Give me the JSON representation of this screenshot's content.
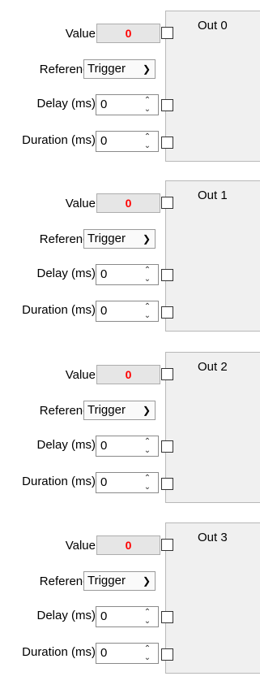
{
  "labels": {
    "value": "Value",
    "reference": "Reference",
    "delay": "Delay (ms)",
    "duration": "Duration (ms)"
  },
  "groups": [
    {
      "title": "Out 0",
      "value": "0",
      "reference": "Trigger",
      "delay": "0",
      "duration": "0"
    },
    {
      "title": "Out 1",
      "value": "0",
      "reference": "Trigger",
      "delay": "0",
      "duration": "0"
    },
    {
      "title": "Out 2",
      "value": "0",
      "reference": "Trigger",
      "delay": "0",
      "duration": "0"
    },
    {
      "title": "Out 3",
      "value": "0",
      "reference": "Trigger",
      "delay": "0",
      "duration": "0"
    }
  ],
  "colors": {
    "value_text": "#ff0000",
    "panel_bg": "#f0f0f0"
  }
}
